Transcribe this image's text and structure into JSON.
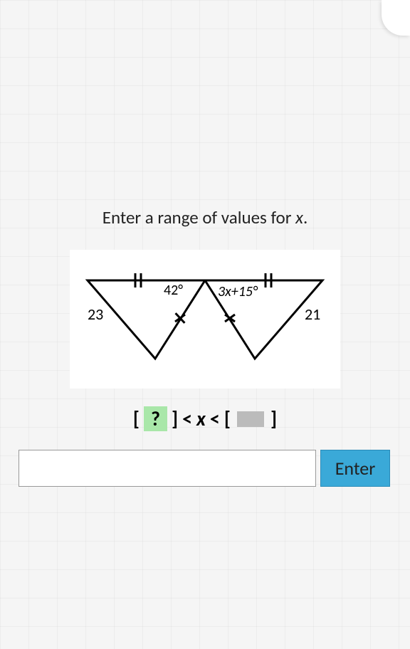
{
  "prompt": {
    "text_before": "Enter a range of values for ",
    "variable": "x",
    "text_after": "."
  },
  "figure": {
    "left_side_label": "23",
    "left_angle_label": "42°",
    "right_angle_label": "3x+15°",
    "right_side_label": "21"
  },
  "expression": {
    "open1": "[",
    "placeholder1": "?",
    "close1": "]",
    "lt1": "<",
    "variable": "x",
    "lt2": "<",
    "open2": "[",
    "close2": "]"
  },
  "input": {
    "value": "",
    "placeholder": ""
  },
  "buttons": {
    "enter": "Enter"
  }
}
